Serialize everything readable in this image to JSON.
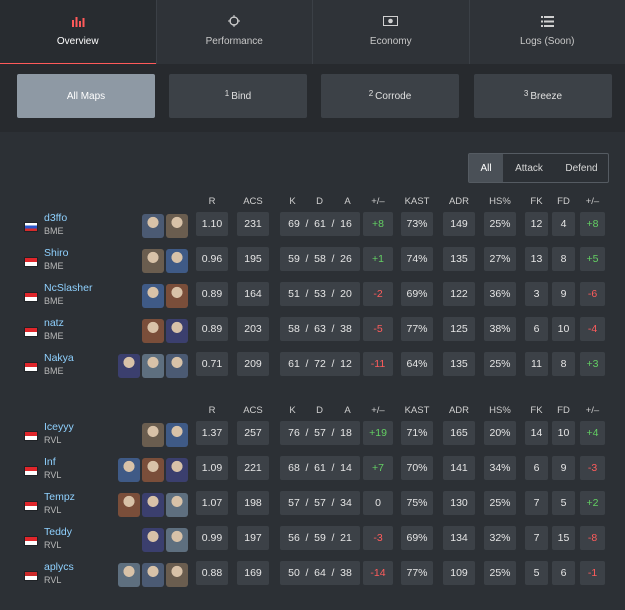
{
  "tabs": [
    {
      "label": "Overview",
      "icon": "bar-chart-icon"
    },
    {
      "label": "Performance",
      "icon": "crosshair-icon"
    },
    {
      "label": "Economy",
      "icon": "money-icon"
    },
    {
      "label": "Logs (Soon)",
      "icon": "list-icon"
    }
  ],
  "maps": [
    {
      "label": "All Maps",
      "num": ""
    },
    {
      "label": "Bind",
      "num": "1"
    },
    {
      "label": "Corrode",
      "num": "2"
    },
    {
      "label": "Breeze",
      "num": "3"
    }
  ],
  "side_filter": [
    "All",
    "Attack",
    "Defend"
  ],
  "headers": [
    "R",
    "ACS",
    "K",
    "D",
    "A",
    "+/–",
    "KAST",
    "ADR",
    "HS%",
    "FK",
    "FD",
    "+/–"
  ],
  "teams": [
    {
      "players": [
        {
          "name": "d3ffo",
          "team": "BME",
          "flag": "ru",
          "agents": [
            "agent-1",
            "agent-2"
          ],
          "r": "1.10",
          "acs": "231",
          "k": "69",
          "d": "61",
          "a": "16",
          "pm": "+8",
          "kast": "73%",
          "adr": "149",
          "hs": "25%",
          "fk": "12",
          "fd": "4",
          "fpm": "+8"
        },
        {
          "name": "Shiro",
          "team": "BME",
          "flag": "id",
          "agents": [
            "agent-1",
            "agent-2"
          ],
          "r": "0.96",
          "acs": "195",
          "k": "59",
          "d": "58",
          "a": "26",
          "pm": "+1",
          "kast": "74%",
          "adr": "135",
          "hs": "27%",
          "fk": "13",
          "fd": "8",
          "fpm": "+5"
        },
        {
          "name": "NcSlasher",
          "team": "BME",
          "flag": "id",
          "agents": [
            "agent-1",
            "agent-2"
          ],
          "r": "0.89",
          "acs": "164",
          "k": "51",
          "d": "53",
          "a": "20",
          "pm": "-2",
          "kast": "69%",
          "adr": "122",
          "hs": "36%",
          "fk": "3",
          "fd": "9",
          "fpm": "-6"
        },
        {
          "name": "natz",
          "team": "BME",
          "flag": "id",
          "agents": [
            "agent-1",
            "agent-2"
          ],
          "r": "0.89",
          "acs": "203",
          "k": "58",
          "d": "63",
          "a": "38",
          "pm": "-5",
          "kast": "77%",
          "adr": "125",
          "hs": "38%",
          "fk": "6",
          "fd": "10",
          "fpm": "-4"
        },
        {
          "name": "Nakya",
          "team": "BME",
          "flag": "id",
          "agents": [
            "agent-1",
            "agent-2",
            "agent-3"
          ],
          "r": "0.71",
          "acs": "209",
          "k": "61",
          "d": "72",
          "a": "12",
          "pm": "-11",
          "kast": "64%",
          "adr": "135",
          "hs": "25%",
          "fk": "11",
          "fd": "8",
          "fpm": "+3"
        }
      ]
    },
    {
      "players": [
        {
          "name": "Iceyyy",
          "team": "RVL",
          "flag": "id",
          "agents": [
            "agent-1",
            "agent-2"
          ],
          "r": "1.37",
          "acs": "257",
          "k": "76",
          "d": "57",
          "a": "18",
          "pm": "+19",
          "kast": "71%",
          "adr": "165",
          "hs": "20%",
          "fk": "14",
          "fd": "10",
          "fpm": "+4"
        },
        {
          "name": "Inf",
          "team": "RVL",
          "flag": "id",
          "agents": [
            "agent-1",
            "agent-2",
            "agent-3"
          ],
          "r": "1.09",
          "acs": "221",
          "k": "68",
          "d": "61",
          "a": "14",
          "pm": "+7",
          "kast": "70%",
          "adr": "141",
          "hs": "34%",
          "fk": "6",
          "fd": "9",
          "fpm": "-3"
        },
        {
          "name": "Tempz",
          "team": "RVL",
          "flag": "id",
          "agents": [
            "agent-1",
            "agent-2",
            "agent-3"
          ],
          "r": "1.07",
          "acs": "198",
          "k": "57",
          "d": "57",
          "a": "34",
          "pm": "0",
          "kast": "75%",
          "adr": "130",
          "hs": "25%",
          "fk": "7",
          "fd": "5",
          "fpm": "+2"
        },
        {
          "name": "Teddy",
          "team": "RVL",
          "flag": "id",
          "agents": [
            "agent-1",
            "agent-2"
          ],
          "r": "0.99",
          "acs": "197",
          "k": "56",
          "d": "59",
          "a": "21",
          "pm": "-3",
          "kast": "69%",
          "adr": "134",
          "hs": "32%",
          "fk": "7",
          "fd": "15",
          "fpm": "-8"
        },
        {
          "name": "aplycs",
          "team": "RVL",
          "flag": "my",
          "agents": [
            "agent-1",
            "agent-2",
            "agent-3"
          ],
          "r": "0.88",
          "acs": "169",
          "k": "50",
          "d": "64",
          "a": "38",
          "pm": "-14",
          "kast": "77%",
          "adr": "109",
          "hs": "25%",
          "fk": "5",
          "fd": "6",
          "fpm": "-1"
        }
      ]
    }
  ],
  "colors": {
    "positive": "#63d063",
    "negative": "#ff5c5c",
    "accent": "#ff5a5a",
    "link": "#8fd1ff"
  }
}
